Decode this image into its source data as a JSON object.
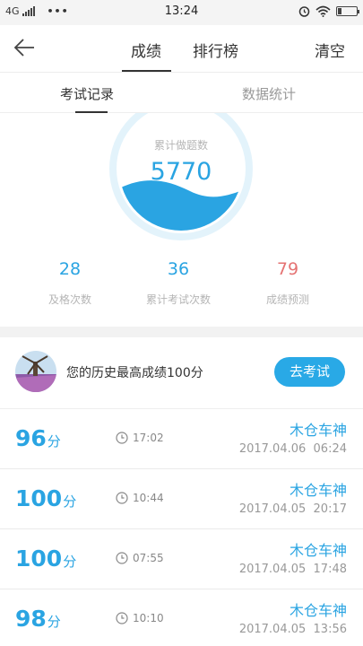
{
  "status_bar": {
    "network": "4G",
    "dots": "•••",
    "time": "13:24"
  },
  "header": {
    "tabs": [
      "成绩",
      "排行榜"
    ],
    "active_tab": "成绩",
    "clear_label": "清空"
  },
  "sub_tabs": {
    "items": [
      "考试记录",
      "数据统计"
    ],
    "active": "考试记录"
  },
  "summary": {
    "circle_label": "累计做题数",
    "circle_value": "5770",
    "stats": [
      {
        "value": "28",
        "label": "及格次数"
      },
      {
        "value": "36",
        "label": "累计考试次数"
      },
      {
        "value": "79",
        "label": "成绩预测"
      }
    ]
  },
  "best": {
    "text": "您的历史最高成绩100分",
    "button": "去考试"
  },
  "records": [
    {
      "score": "96",
      "unit": "分",
      "time": "17:02",
      "name": "木仓车神",
      "date": "2017.04.06  06:24"
    },
    {
      "score": "100",
      "unit": "分",
      "time": "10:44",
      "name": "木仓车神",
      "date": "2017.04.05  20:17"
    },
    {
      "score": "100",
      "unit": "分",
      "time": "07:55",
      "name": "木仓车神",
      "date": "2017.04.05  17:48"
    },
    {
      "score": "98",
      "unit": "分",
      "time": "10:10",
      "name": "木仓车神",
      "date": "2017.04.05  13:56"
    }
  ],
  "colors": {
    "accent": "#2aa4e2",
    "prediction": "#e57373",
    "button": "#29a9e6"
  },
  "icons": [
    "back-arrow-icon",
    "clock-icon",
    "alarm-icon",
    "wifi-icon",
    "battery-icon",
    "signal-icon"
  ]
}
